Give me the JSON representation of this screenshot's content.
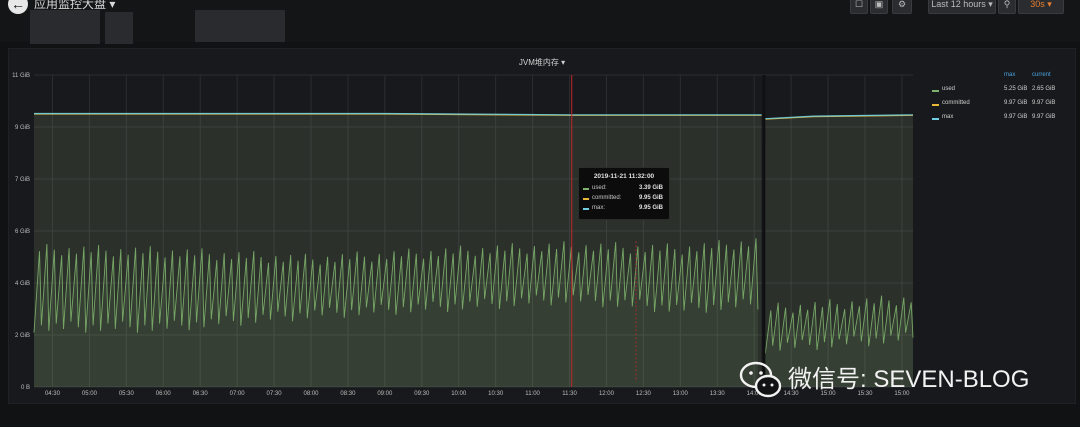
{
  "dashboard": {
    "title": "应用监控大盘",
    "back_icon": "arrow-left-icon",
    "caret": "▾"
  },
  "toolbar": {
    "time_range": "Last 12 hours ▾",
    "refresh_interval": "30s ▾"
  },
  "panel": {
    "title": "JVM堆内存 ▾"
  },
  "legend": {
    "headers": {
      "max": "max",
      "current": "current"
    },
    "items": [
      {
        "name": "used",
        "max": "5.25 GiB",
        "current": "2.65 GiB",
        "color": "#7eb26d"
      },
      {
        "name": "committed",
        "max": "9.97 GiB",
        "current": "9.97 GiB",
        "color": "#eab839"
      },
      {
        "name": "max",
        "max": "9.97 GiB",
        "current": "9.97 GiB",
        "color": "#6ed0e0"
      }
    ]
  },
  "tooltip": {
    "time": "2019-11-21 11:32:00",
    "items": [
      {
        "name": "used:",
        "value": "3.39 GiB",
        "color": "#7eb26d"
      },
      {
        "name": "committed:",
        "value": "9.95 GiB",
        "color": "#eab839"
      },
      {
        "name": "max:",
        "value": "9.95 GiB",
        "color": "#6ed0e0"
      }
    ]
  },
  "watermark": {
    "text": "微信号: SEVEN-BLOG"
  },
  "chart_data": {
    "type": "area",
    "title": "JVM堆内存",
    "y_ticks": [
      "0 B",
      "2 GiB",
      "4 GiB",
      "6 GiB",
      "7 GiB",
      "9 GiB",
      "11 GiB"
    ],
    "y_tick_values": [
      0,
      2,
      4,
      6,
      8,
      10,
      12
    ],
    "ylim": [
      0,
      12
    ],
    "x_ticks": [
      "04:30",
      "05:00",
      "05:30",
      "06:00",
      "06:30",
      "07:00",
      "07:30",
      "08:00",
      "08:30",
      "09:00",
      "09:30",
      "10:00",
      "10:30",
      "11:00",
      "11:30",
      "12:00",
      "12:30",
      "13:00",
      "13:30",
      "14:00",
      "14:30",
      "15:00",
      "15:30",
      "15:00"
    ],
    "x_tick_hours": [
      4.5,
      5,
      5.5,
      6,
      6.5,
      7,
      7.5,
      8,
      8.5,
      9,
      9.5,
      10,
      10.5,
      11,
      11.5,
      12,
      12.5,
      13,
      13.5,
      14,
      14.5,
      15,
      15.5,
      16
    ],
    "xlim": [
      4.25,
      16.15
    ],
    "gap": [
      14.1,
      14.15
    ],
    "hover_hour": 11.53,
    "series": [
      {
        "name": "used",
        "color": "#7eb26d",
        "segments": [
          {
            "sawtooth": true,
            "from": 4.25,
            "to": 14.1,
            "period": 0.1,
            "peaks": [
              [
                4.25,
                5.3
              ],
              [
                6.0,
                5.2
              ],
              [
                8.0,
                4.9
              ],
              [
                10.5,
                5.3
              ],
              [
                11.5,
                5.4
              ],
              [
                13.0,
                5.3
              ],
              [
                14.1,
                5.6
              ]
            ],
            "troughs": [
              [
                4.25,
                2.3
              ],
              [
                6.0,
                2.3
              ],
              [
                8.0,
                2.8
              ],
              [
                10.5,
                3.2
              ],
              [
                11.5,
                3.4
              ],
              [
                13.0,
                3.0
              ],
              [
                14.1,
                3.2
              ]
            ]
          },
          {
            "sawtooth": true,
            "from": 14.15,
            "to": 16.15,
            "period": 0.1,
            "peaks": [
              [
                14.15,
                3.0
              ],
              [
                15.2,
                3.2
              ],
              [
                16.15,
                3.4
              ]
            ],
            "troughs": [
              [
                14.15,
                1.5
              ],
              [
                15.2,
                1.7
              ],
              [
                16.15,
                1.9
              ]
            ]
          }
        ]
      },
      {
        "name": "committed",
        "color": "#eab839",
        "segments": [
          {
            "points": [
              [
                4.25,
                10.5
              ],
              [
                9.0,
                10.5
              ],
              [
                11.5,
                10.45
              ],
              [
                14.1,
                10.45
              ]
            ]
          },
          {
            "points": [
              [
                14.15,
                10.3
              ],
              [
                14.8,
                10.4
              ],
              [
                16.15,
                10.45
              ]
            ]
          }
        ]
      },
      {
        "name": "max",
        "color": "#6ed0e0",
        "segments": [
          {
            "points": [
              [
                4.25,
                10.52
              ],
              [
                9.0,
                10.52
              ],
              [
                11.5,
                10.47
              ],
              [
                14.1,
                10.47
              ]
            ]
          },
          {
            "points": [
              [
                14.15,
                10.32
              ],
              [
                14.8,
                10.42
              ],
              [
                16.15,
                10.47
              ]
            ]
          }
        ]
      }
    ]
  }
}
